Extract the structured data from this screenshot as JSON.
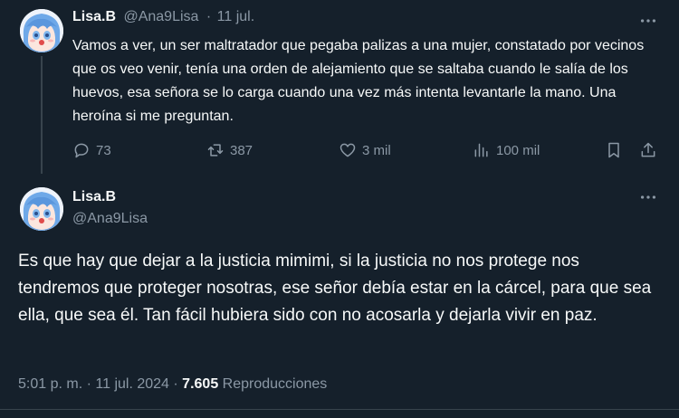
{
  "tweet1": {
    "author_name": "Lisa.B",
    "handle": "@Ana9Lisa",
    "separator": "·",
    "date": "11 jul.",
    "text": "Vamos a ver, un ser maltratador que pegaba palizas a una mujer, constatado por vecinos que os veo venir, tenía una orden de alejamiento que se saltaba cuando le salía de los huevos, esa señora se lo carga cuando una vez más intenta levantarle la mano. Una heroína si me preguntan.",
    "replies": "73",
    "reposts": "387",
    "likes": "3 mil",
    "views": "100 mil",
    "more_icon": "more-horizontal-icon",
    "reply_icon": "reply-bubble-icon",
    "repost_icon": "repost-arrows-icon",
    "like_icon": "heart-icon",
    "views_icon": "bar-chart-icon",
    "bookmark_icon": "bookmark-icon",
    "share_icon": "share-upload-icon"
  },
  "tweet2": {
    "author_name": "Lisa.B",
    "handle": "@Ana9Lisa",
    "text": "Es que hay que dejar a la justicia mimimi, si la justicia no nos protege nos tendremos que proteger nosotras, ese señor debía estar en la cárcel, para que sea ella, que sea él. Tan fácil hubiera sido con no acosarla y dejarla vivir en paz.",
    "time": "5:01 p. m.",
    "separator1": "·",
    "date": "11 jul. 2024",
    "separator2": "·",
    "views_count": "7.605",
    "views_label": "Reproducciones",
    "more_icon": "more-horizontal-icon"
  },
  "colors": {
    "background": "#15202b",
    "text": "#f7f9f9",
    "muted": "#8b98a5",
    "border": "#38444d"
  }
}
